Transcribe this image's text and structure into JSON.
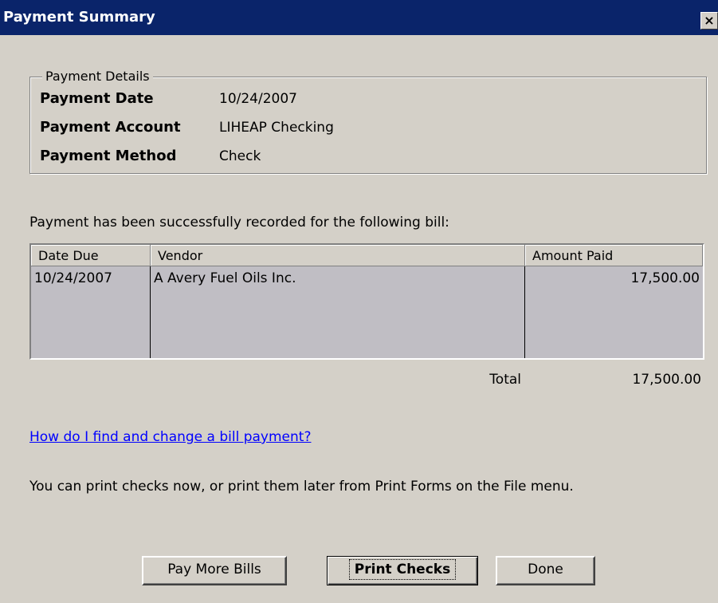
{
  "window": {
    "title": "Payment Summary",
    "close_label": "×"
  },
  "payment_details": {
    "legend": "Payment Details",
    "rows": [
      {
        "label": "Payment Date",
        "value": "10/24/2007"
      },
      {
        "label": "Payment Account",
        "value": "LIHEAP Checking"
      },
      {
        "label": "Payment Method",
        "value": "Check"
      }
    ]
  },
  "message": "Payment has been successfully recorded for the following bill:",
  "bills_table": {
    "columns": [
      "Date Due",
      "Vendor",
      "Amount Paid"
    ],
    "rows": [
      {
        "date_due": "10/24/2007",
        "vendor": "A Avery Fuel Oils Inc.",
        "amount_paid": "17,500.00"
      }
    ]
  },
  "total": {
    "label": "Total",
    "value": "17,500.00"
  },
  "help_link": "How do I find and change a bill payment?",
  "print_note": "You can print checks now, or print them later from Print Forms on the File menu.",
  "buttons": {
    "pay_more": "Pay More Bills",
    "print_checks": "Print Checks",
    "done": "Done"
  },
  "colors": {
    "titlebar": "#0a246a",
    "dialog_bg": "#d4d0c8",
    "grid_body": "#c0bec4",
    "link": "#0000ff"
  }
}
